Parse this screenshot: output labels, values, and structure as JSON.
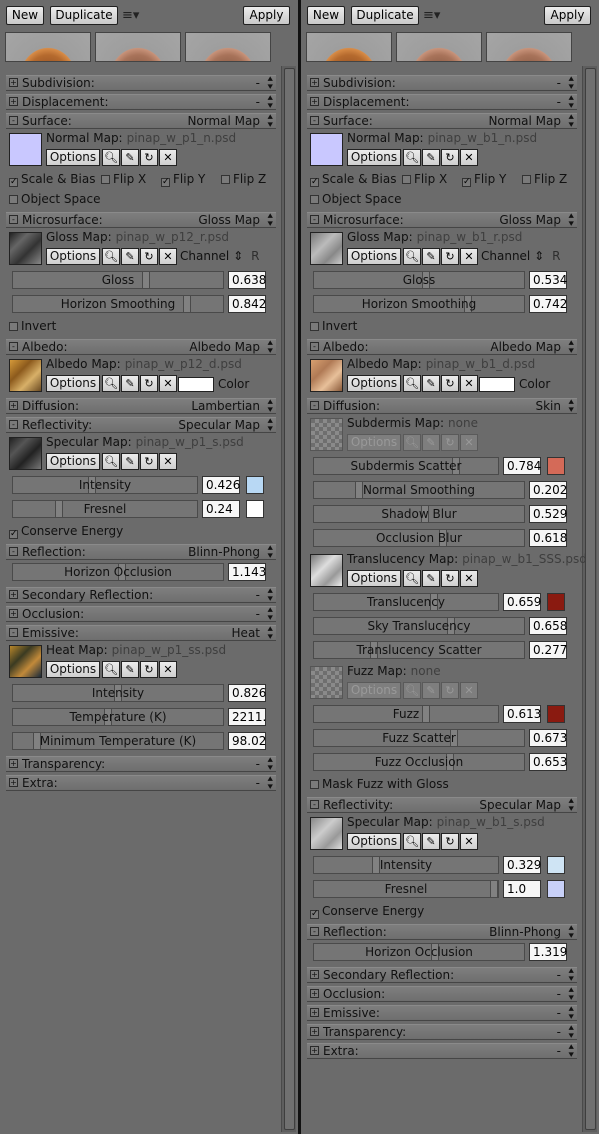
{
  "toolbar": {
    "new_label": "New",
    "duplicate_label": "Duplicate",
    "menu_label": "≡▾",
    "apply_label": "Apply"
  },
  "common": {
    "options": "Options",
    "channel": "Channel ⇕",
    "color": "Color",
    "minus": "-",
    "plus": "+",
    "check": "✓"
  },
  "left": {
    "subdivision": {
      "title": "Subdivision:",
      "value": "-"
    },
    "displacement": {
      "title": "Displacement:",
      "value": "-"
    },
    "surface": {
      "title": "Surface:",
      "value": "Normal Map",
      "map_label": "Normal Map:",
      "map_file": "pinap_w_p1_n.psd",
      "scale_bias": "Scale & Bias",
      "flip_x": "Flip X",
      "flip_y": "Flip Y",
      "flip_z": "Flip Z",
      "object_space": "Object Space"
    },
    "microsurface": {
      "title": "Microsurface:",
      "value": "Gloss Map",
      "map_label": "Gloss Map:",
      "map_file": "pinap_w_p12_r.psd",
      "channel_value": "R",
      "gloss_label": "Gloss",
      "gloss_value": "0.638",
      "gloss": 0.638,
      "horizon_label": "Horizon Smoothing",
      "horizon_value": "0.842",
      "horizon": 0.842,
      "invert": "Invert"
    },
    "albedo": {
      "title": "Albedo:",
      "value": "Albedo Map",
      "map_label": "Albedo Map:",
      "map_file": "pinap_w_p12_d.psd",
      "color_hex": "#ffffff"
    },
    "diffusion": {
      "title": "Diffusion:",
      "value": "Lambertian"
    },
    "reflectivity": {
      "title": "Reflectivity:",
      "value": "Specular Map",
      "map_label": "Specular Map:",
      "map_file": "pinap_w_p1_s.psd",
      "intensity_label": "Intensity",
      "intensity_value": "0.426",
      "intensity": 0.426,
      "intensity_color": "#b8d8f4",
      "fresnel_label": "Fresnel",
      "fresnel_value": "0.24",
      "fresnel": 0.24,
      "fresnel_color": "#ffffff",
      "conserve": "Conserve Energy"
    },
    "reflection": {
      "title": "Reflection:",
      "value": "Blinn-Phong",
      "horizon_label": "Horizon Occlusion",
      "horizon_value": "1.143",
      "horizon": 0.52
    },
    "secondary": {
      "title": "Secondary Reflection:",
      "value": "-"
    },
    "occlusion": {
      "title": "Occlusion:",
      "value": "-"
    },
    "emissive": {
      "title": "Emissive:",
      "value": "Heat",
      "map_label": "Heat Map:",
      "map_file": "pinap_w_p1_ss.psd",
      "intensity_label": "Intensity",
      "intensity_value": "0.826",
      "intensity": 0.5,
      "temp_label": "Temperature (K)",
      "temp_value": "2211.",
      "temp": 0.45,
      "mintemp_label": "Minimum Temperature (K)",
      "mintemp_value": "98.02",
      "mintemp": 0.1
    },
    "transparency": {
      "title": "Transparency:",
      "value": "-"
    },
    "extra": {
      "title": "Extra:",
      "value": "-"
    }
  },
  "right": {
    "subdivision": {
      "title": "Subdivision:",
      "value": "-"
    },
    "displacement": {
      "title": "Displacement:",
      "value": "-"
    },
    "surface": {
      "title": "Surface:",
      "value": "Normal Map",
      "map_label": "Normal Map:",
      "map_file": "pinap_w_b1_n.psd",
      "scale_bias": "Scale & Bias",
      "flip_x": "Flip X",
      "flip_y": "Flip Y",
      "flip_z": "Flip Z",
      "object_space": "Object Space"
    },
    "microsurface": {
      "title": "Microsurface:",
      "value": "Gloss Map",
      "map_label": "Gloss Map:",
      "map_file": "pinap_w_b1_r.psd",
      "channel_value": "R",
      "gloss_label": "Gloss",
      "gloss_value": "0.534",
      "gloss": 0.534,
      "horizon_label": "Horizon Smoothing",
      "horizon_value": "0.742",
      "horizon": 0.742,
      "invert": "Invert"
    },
    "albedo": {
      "title": "Albedo:",
      "value": "Albedo Map",
      "map_label": "Albedo Map:",
      "map_file": "pinap_w_b1_d.psd",
      "color_hex": "#ffffff"
    },
    "diffusion": {
      "title": "Diffusion:",
      "value": "Skin",
      "subdermis_label": "Subdermis Map:",
      "subdermis_file": "none",
      "sub_scatter_label": "Subdermis Scatter",
      "sub_scatter_value": "0.784",
      "sub_scatter": 0.784,
      "sub_scatter_color": "#d46a58",
      "normal_smooth_label": "Normal Smoothing",
      "normal_smooth_value": "0.202",
      "normal_smooth": 0.202,
      "shadow_blur_label": "Shadow Blur",
      "shadow_blur_value": "0.529",
      "shadow_blur": 0.529,
      "occlusion_blur_label": "Occlusion Blur",
      "occlusion_blur_value": "0.618",
      "occlusion_blur": 0.618,
      "transl_map_label": "Translucency Map:",
      "transl_map_file": "pinap_w_b1_SSS.psd",
      "transl_label": "Translucency",
      "transl_value": "0.659",
      "transl": 0.659,
      "transl_color": "#8a1a10",
      "sky_transl_label": "Sky Translucency",
      "sky_transl_value": "0.658",
      "sky_transl": 0.658,
      "transl_scatter_label": "Translucency Scatter",
      "transl_scatter_value": "0.277",
      "transl_scatter": 0.277,
      "fuzz_map_label": "Fuzz Map:",
      "fuzz_map_file": "none",
      "fuzz_label": "Fuzz",
      "fuzz_value": "0.613",
      "fuzz": 0.613,
      "fuzz_color": "#8a1a10",
      "fuzz_scatter_label": "Fuzz Scatter",
      "fuzz_scatter_value": "0.673",
      "fuzz_scatter": 0.673,
      "fuzz_occl_label": "Fuzz Occlusion",
      "fuzz_occl_value": "0.653",
      "fuzz_occl": 0.653,
      "mask_fuzz": "Mask Fuzz with Gloss"
    },
    "reflectivity": {
      "title": "Reflectivity:",
      "value": "Specular Map",
      "map_label": "Specular Map:",
      "map_file": "pinap_w_b1_s.psd",
      "intensity_label": "Intensity",
      "intensity_value": "0.329",
      "intensity": 0.329,
      "intensity_color": "#cfe4f4",
      "fresnel_label": "Fresnel",
      "fresnel_value": "1.0",
      "fresnel": 1.0,
      "fresnel_color": "#c8d0f8",
      "conserve": "Conserve Energy"
    },
    "reflection": {
      "title": "Reflection:",
      "value": "Blinn-Phong",
      "horizon_label": "Horizon Occlusion",
      "horizon_value": "1.319",
      "horizon": 0.58
    },
    "secondary": {
      "title": "Secondary Reflection:",
      "value": "-"
    },
    "occlusion": {
      "title": "Occlusion:",
      "value": "-"
    },
    "emissive": {
      "title": "Emissive:",
      "value": "-"
    },
    "transparency": {
      "title": "Transparency:",
      "value": "-"
    },
    "extra": {
      "title": "Extra:",
      "value": "-"
    }
  }
}
